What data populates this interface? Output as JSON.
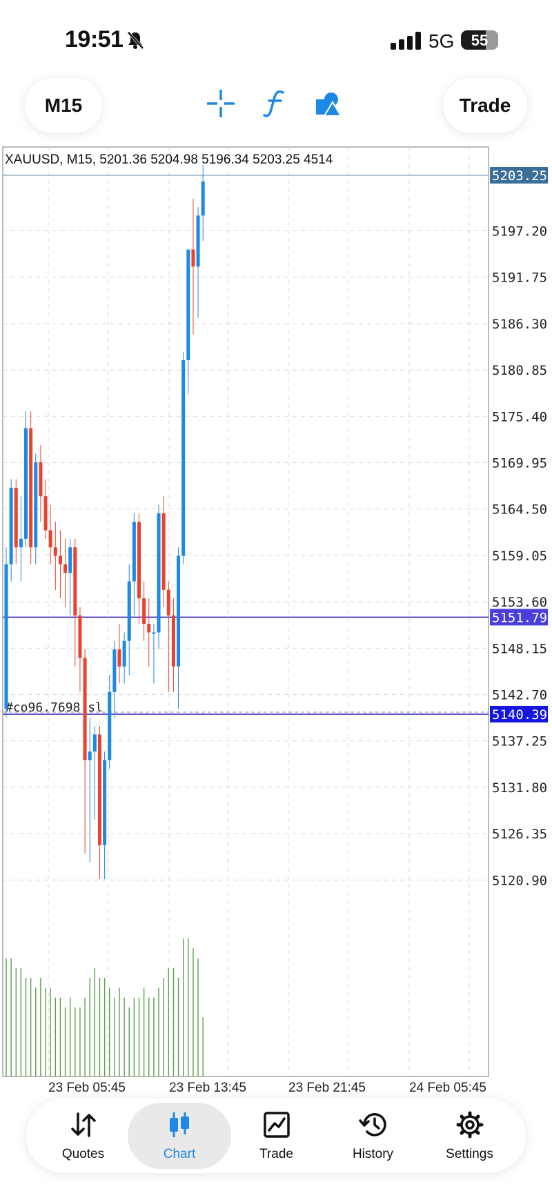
{
  "status_bar": {
    "time": "19:51",
    "network": "5G",
    "battery": "55"
  },
  "toolbar": {
    "timeframe": "M15",
    "tools": [
      {
        "icon": "crosshair-icon"
      },
      {
        "icon": "function-icon"
      },
      {
        "icon": "objects-icon"
      }
    ],
    "trade_label": "Trade"
  },
  "chart": {
    "info": "XAUUSD, M15, 5201.36 5204.98 5196.34 5203.25 4514",
    "current_price": "5203.25",
    "price_ticks": [
      "5197.20",
      "5191.75",
      "5186.30",
      "5180.85",
      "5175.40",
      "5169.95",
      "5164.50",
      "5159.05",
      "5153.60",
      "5148.15",
      "5142.70",
      "5137.25",
      "5131.80",
      "5126.35",
      "5120.90"
    ],
    "time_ticks": [
      "23 Feb 05:45",
      "23 Feb 13:45",
      "23 Feb 21:45",
      "24 Feb 05:45"
    ],
    "lines": [
      {
        "price": "5151.79",
        "label": ""
      },
      {
        "price": "5140.39",
        "label": "#co96.7698 sl"
      }
    ],
    "colors": {
      "bull": "#1e88e5",
      "bear": "#e8432e",
      "volume": "#5aa04a",
      "line": "#2b1fbf",
      "current": "#3a6f9a"
    }
  },
  "chart_data": {
    "type": "candlestick",
    "symbol": "XAUUSD",
    "timeframe": "M15",
    "ylim": [
      5115,
      5206
    ],
    "ohlc": [
      [
        5141,
        5160,
        5140,
        5158
      ],
      [
        5158,
        5168,
        5156,
        5167
      ],
      [
        5167,
        5168,
        5158,
        5160
      ],
      [
        5160,
        5166,
        5156,
        5161
      ],
      [
        5161,
        5176,
        5160,
        5174
      ],
      [
        5174,
        5176,
        5158,
        5160
      ],
      [
        5160,
        5171,
        5158,
        5170
      ],
      [
        5170,
        5172,
        5163,
        5166
      ],
      [
        5166,
        5168,
        5161,
        5162
      ],
      [
        5162,
        5165,
        5158,
        5160
      ],
      [
        5160,
        5163,
        5155,
        5159
      ],
      [
        5159,
        5162,
        5154,
        5158
      ],
      [
        5158,
        5161,
        5153,
        5157
      ],
      [
        5157,
        5161,
        5152,
        5160
      ],
      [
        5160,
        5161,
        5146,
        5152
      ],
      [
        5152,
        5153,
        5143,
        5147
      ],
      [
        5147,
        5148,
        5124,
        5135
      ],
      [
        5135,
        5140,
        5123,
        5136
      ],
      [
        5136,
        5139,
        5128,
        5138
      ],
      [
        5138,
        5139,
        5121,
        5125
      ],
      [
        5125,
        5136,
        5121,
        5135
      ],
      [
        5135,
        5145,
        5134,
        5143
      ],
      [
        5143,
        5149,
        5140,
        5148
      ],
      [
        5148,
        5151,
        5144,
        5146
      ],
      [
        5146,
        5150,
        5144,
        5149
      ],
      [
        5149,
        5158,
        5145,
        5156
      ],
      [
        5156,
        5164,
        5152,
        5163
      ],
      [
        5163,
        5164,
        5151,
        5154
      ],
      [
        5154,
        5156,
        5149,
        5151
      ],
      [
        5151,
        5154,
        5146,
        5150
      ],
      [
        5150,
        5151,
        5144,
        5150
      ],
      [
        5150,
        5165,
        5148,
        5164
      ],
      [
        5164,
        5166,
        5153,
        5155
      ],
      [
        5155,
        5156,
        5143,
        5152
      ],
      [
        5152,
        5154,
        5143,
        5146
      ],
      [
        5146,
        5160,
        5141,
        5159
      ],
      [
        5159,
        5183,
        5158,
        5182
      ],
      [
        5182,
        5191,
        5178,
        5195
      ],
      [
        5195,
        5201,
        5185,
        5193
      ],
      [
        5193,
        5200,
        5187,
        5199
      ],
      [
        5199,
        5205,
        5196,
        5203
      ]
    ],
    "volume": [
      12,
      12,
      11,
      11,
      10,
      10,
      9,
      10,
      9,
      9,
      8,
      8,
      7,
      8,
      7,
      7,
      8,
      10,
      11,
      10,
      10,
      9,
      8,
      9,
      8,
      7,
      8,
      8,
      9,
      8,
      8,
      9,
      10,
      11,
      11,
      10,
      14,
      14,
      13,
      12,
      6
    ],
    "levels": [
      5151.79,
      5140.39
    ],
    "x_ticks": [
      "23 Feb 05:45",
      "23 Feb 13:45",
      "23 Feb 21:45",
      "24 Feb 05:45"
    ]
  },
  "bottom_nav": [
    {
      "label": "Quotes",
      "icon": "quotes-arrows-icon",
      "active": false
    },
    {
      "label": "Chart",
      "icon": "candles-icon",
      "active": true
    },
    {
      "label": "Trade",
      "icon": "trade-chart-icon",
      "active": false
    },
    {
      "label": "History",
      "icon": "history-clock-icon",
      "active": false
    },
    {
      "label": "Settings",
      "icon": "gear-icon",
      "active": false
    }
  ]
}
